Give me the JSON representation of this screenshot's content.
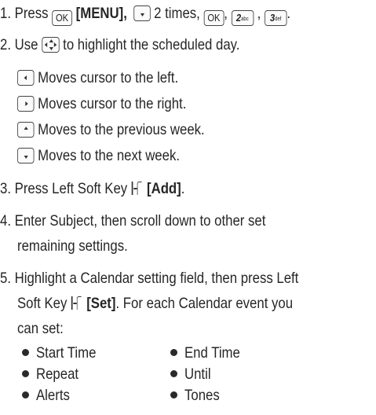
{
  "step1": {
    "prefix": "1. Press",
    "ok_key": "OK",
    "menu": "[MENU],",
    "times": "2 times,",
    "sep1": ",",
    "key2_digit": "2",
    "key2_letters": "abc",
    "sep2": ",",
    "key3_digit": "3",
    "key3_letters": "def",
    "end": "."
  },
  "step2": {
    "prefix": "2. Use",
    "suffix": "to highlight the scheduled day.",
    "sub": [
      {
        "icon": "left-key-icon",
        "text": "Moves cursor to the left."
      },
      {
        "icon": "right-key-icon",
        "text": "Moves cursor to the right."
      },
      {
        "icon": "up-key-icon",
        "text": "Moves to the previous week."
      },
      {
        "icon": "down-key-icon",
        "text": "Moves to the next week."
      }
    ]
  },
  "step3": {
    "prefix": "3. Press Left Soft Key",
    "label": "[Add]",
    "end": "."
  },
  "step4": {
    "line1": "4. Enter Subject, then scroll down to other set",
    "line2": "remaining settings."
  },
  "step5": {
    "line1": "5. Highlight a Calendar setting field, then press Left",
    "line2_prefix": "Soft Key",
    "line2_label": "[Set]",
    "line2_suffix": ". For each Calendar event you",
    "line3": "can set:"
  },
  "settings": [
    "Start Time",
    "End Time",
    "Repeat",
    "Until",
    "Alerts",
    "Tones"
  ]
}
